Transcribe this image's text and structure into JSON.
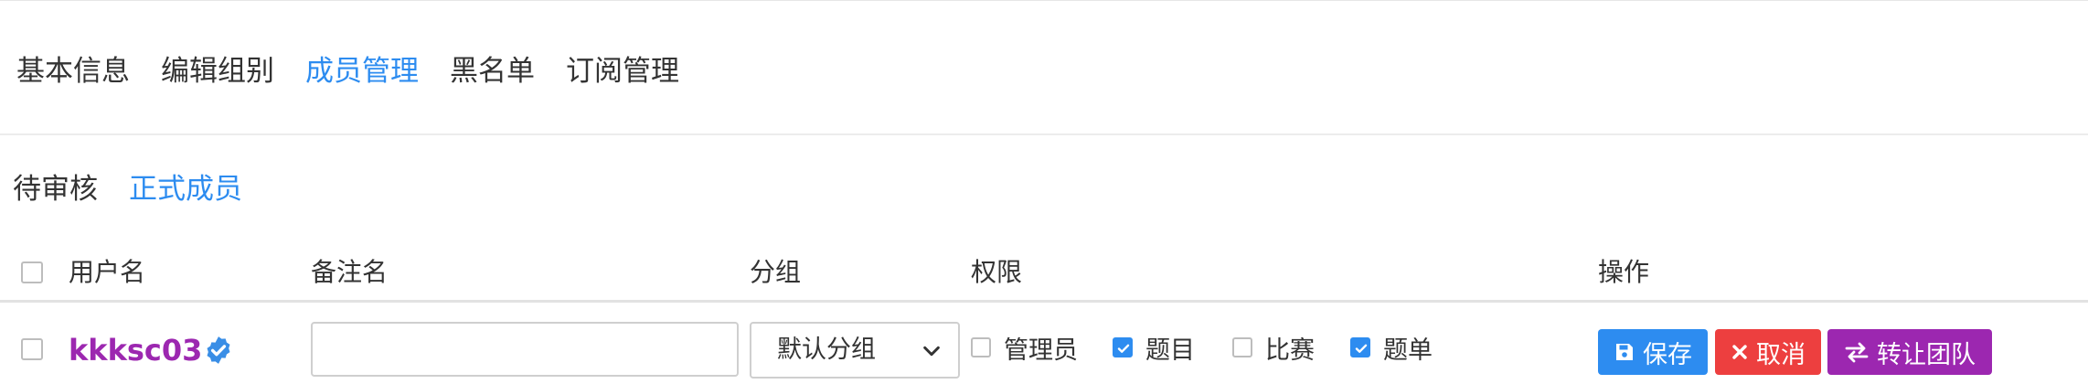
{
  "tabs": [
    {
      "label": "基本信息",
      "active": false
    },
    {
      "label": "编辑组别",
      "active": false
    },
    {
      "label": "成员管理",
      "active": true
    },
    {
      "label": "黑名单",
      "active": false
    },
    {
      "label": "订阅管理",
      "active": false
    }
  ],
  "subtabs": [
    {
      "label": "待审核",
      "active": false
    },
    {
      "label": "正式成员",
      "active": true
    }
  ],
  "table": {
    "headers": {
      "username": "用户名",
      "remark": "备注名",
      "group": "分组",
      "permissions": "权限",
      "actions": "操作"
    },
    "row": {
      "username": "kkksc03",
      "verified_icon": "verified-badge-icon",
      "remark_value": "",
      "group_selected": "默认分组",
      "permissions": [
        {
          "label": "管理员",
          "checked": false
        },
        {
          "label": "题目",
          "checked": true
        },
        {
          "label": "比赛",
          "checked": false
        },
        {
          "label": "题单",
          "checked": true
        }
      ],
      "actions": {
        "save": "保存",
        "cancel": "取消",
        "transfer": "转让团队"
      }
    }
  },
  "colors": {
    "accent": "#2d8cf0",
    "username": "#9c27b0",
    "save": "#2d8cf0",
    "cancel": "#ed3f3f",
    "transfer": "#9c27b0"
  }
}
